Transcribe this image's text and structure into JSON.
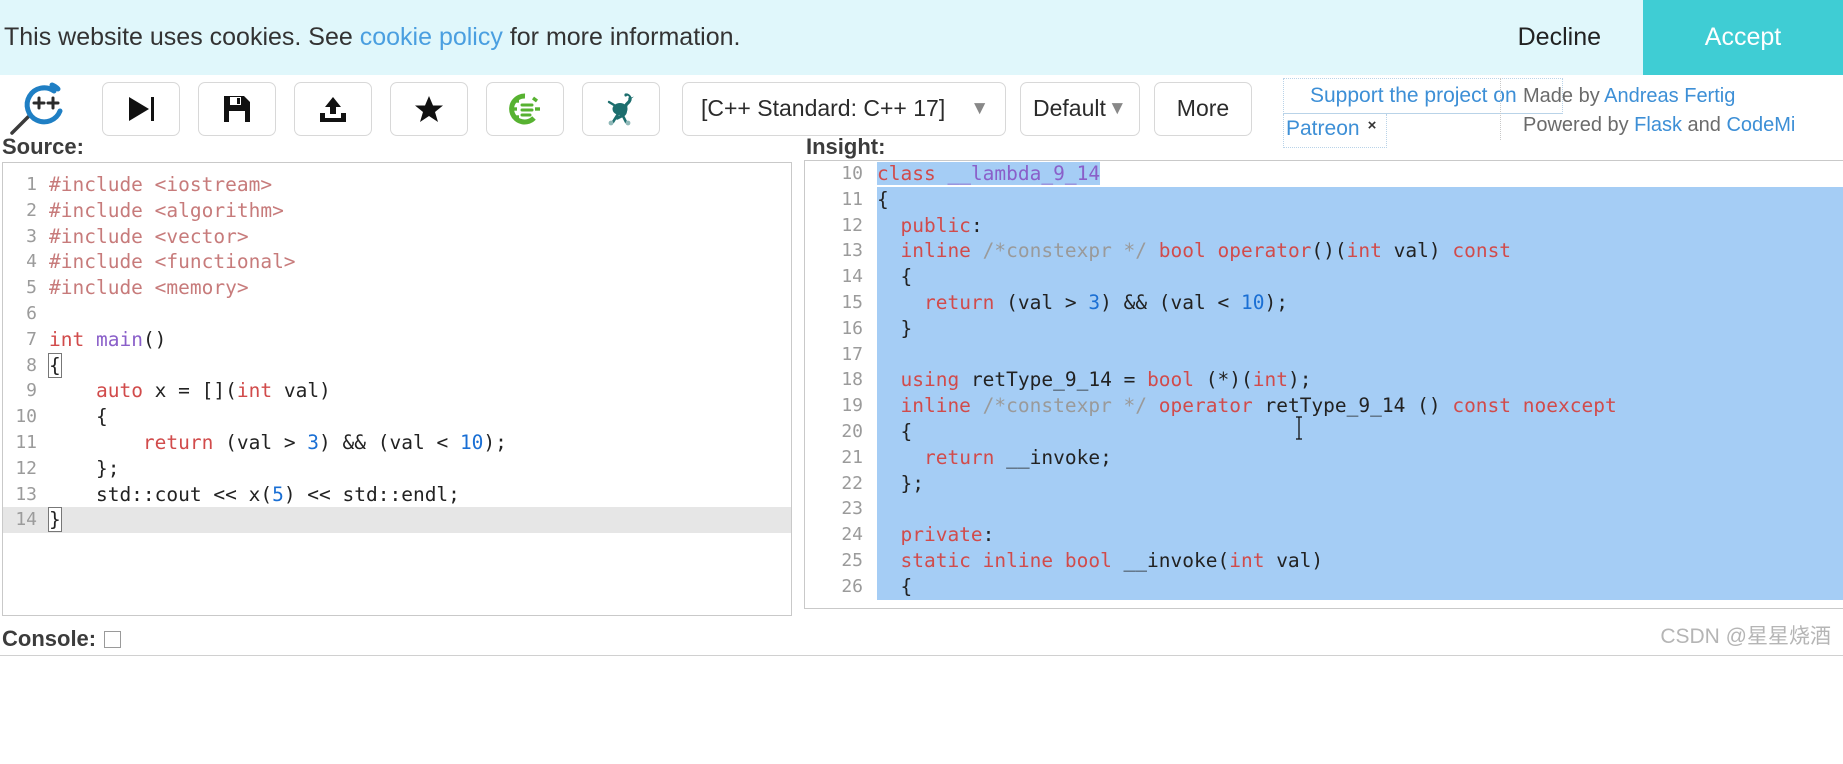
{
  "cookie": {
    "text_before": "This website uses cookies. See ",
    "link": "cookie policy",
    "text_after": " for more information.",
    "decline": "Decline",
    "accept": "Accept",
    "bg": "#e0f7fb",
    "accept_bg": "#3fcdd4"
  },
  "toolbar": {
    "logo_name": "cpp-insights-logo",
    "buttons": [
      {
        "name": "run-button",
        "icon": "play-icon"
      },
      {
        "name": "save-button",
        "icon": "floppy-disk-icon"
      },
      {
        "name": "share-button",
        "icon": "upload-icon"
      },
      {
        "name": "favorite-button",
        "icon": "star-icon"
      },
      {
        "name": "options-button",
        "icon": "green-gear-icon"
      },
      {
        "name": "compiler-explorer-button",
        "icon": "ostrich-icon"
      }
    ],
    "standard_select": "[C++ Standard: C++ 17]",
    "default_select": "Default",
    "more": "More",
    "caret": "▼"
  },
  "patreon": {
    "line1": "Support the project on",
    "line2": "Patreon",
    "close": "×"
  },
  "credits": {
    "line1_prefix": "Made by ",
    "line1_link": "Andreas Fertig",
    "line2_prefix": "Powered by ",
    "line2_link1": "Flask",
    "line2_mid": " and ",
    "line2_link2": "CodeMi"
  },
  "panes": {
    "source_label": "Source:",
    "insight_label": "Insight:"
  },
  "source_code": [
    {
      "n": "1",
      "tokens": [
        {
          "t": "#include ",
          "c": "pp"
        },
        {
          "t": "<iostream>",
          "c": "pp"
        }
      ]
    },
    {
      "n": "2",
      "tokens": [
        {
          "t": "#include ",
          "c": "pp"
        },
        {
          "t": "<algorithm>",
          "c": "pp"
        }
      ]
    },
    {
      "n": "3",
      "tokens": [
        {
          "t": "#include ",
          "c": "pp"
        },
        {
          "t": "<vector>",
          "c": "pp"
        }
      ]
    },
    {
      "n": "4",
      "tokens": [
        {
          "t": "#include ",
          "c": "pp"
        },
        {
          "t": "<functional>",
          "c": "pp"
        }
      ]
    },
    {
      "n": "5",
      "tokens": [
        {
          "t": "#include ",
          "c": "pp"
        },
        {
          "t": "<memory>",
          "c": "pp"
        }
      ]
    },
    {
      "n": "6",
      "tokens": []
    },
    {
      "n": "7",
      "tokens": [
        {
          "t": "int ",
          "c": "kw"
        },
        {
          "t": "main",
          "c": "fn"
        },
        {
          "t": "()",
          "c": "plain"
        }
      ]
    },
    {
      "n": "8",
      "tokens": [
        {
          "t": "{",
          "c": "plain",
          "box": true
        }
      ]
    },
    {
      "n": "9",
      "tokens": [
        {
          "t": "    ",
          "c": "plain"
        },
        {
          "t": "auto",
          "c": "kw"
        },
        {
          "t": " x = [](",
          "c": "plain"
        },
        {
          "t": "int",
          "c": "kw"
        },
        {
          "t": " val)",
          "c": "plain"
        }
      ]
    },
    {
      "n": "10",
      "tokens": [
        {
          "t": "    {",
          "c": "plain"
        }
      ]
    },
    {
      "n": "11",
      "tokens": [
        {
          "t": "        ",
          "c": "plain"
        },
        {
          "t": "return",
          "c": "kw"
        },
        {
          "t": " (val > ",
          "c": "plain"
        },
        {
          "t": "3",
          "c": "num"
        },
        {
          "t": ") && (val < ",
          "c": "plain"
        },
        {
          "t": "10",
          "c": "num"
        },
        {
          "t": ");",
          "c": "plain"
        }
      ]
    },
    {
      "n": "12",
      "tokens": [
        {
          "t": "    };",
          "c": "plain"
        }
      ]
    },
    {
      "n": "13",
      "tokens": [
        {
          "t": "    std::cout << x(",
          "c": "plain"
        },
        {
          "t": "5",
          "c": "num"
        },
        {
          "t": ") << std::endl;",
          "c": "plain"
        }
      ]
    },
    {
      "n": "14",
      "tokens": [
        {
          "t": "}",
          "c": "plain",
          "box": true
        }
      ],
      "active": true
    }
  ],
  "insight_code": [
    {
      "n": "10",
      "sel": "partial",
      "tokens": [
        {
          "t": "class ",
          "c": "kw"
        },
        {
          "t": "__lambda_9_14",
          "c": "fn"
        }
      ]
    },
    {
      "n": "11",
      "sel": "full",
      "tokens": [
        {
          "t": "{",
          "c": "plain"
        }
      ]
    },
    {
      "n": "12",
      "sel": "full",
      "tokens": [
        {
          "t": "  ",
          "c": "plain"
        },
        {
          "t": "public",
          "c": "kw"
        },
        {
          "t": ":",
          "c": "plain"
        }
      ]
    },
    {
      "n": "13",
      "sel": "full",
      "tokens": [
        {
          "t": "  ",
          "c": "plain"
        },
        {
          "t": "inline ",
          "c": "kw"
        },
        {
          "t": "/*constexpr */",
          "c": "cm"
        },
        {
          "t": " ",
          "c": "plain"
        },
        {
          "t": "bool ",
          "c": "kw"
        },
        {
          "t": "operator",
          "c": "kw"
        },
        {
          "t": "()(",
          "c": "plain"
        },
        {
          "t": "int",
          "c": "kw"
        },
        {
          "t": " val) ",
          "c": "plain"
        },
        {
          "t": "const",
          "c": "kw"
        }
      ]
    },
    {
      "n": "14",
      "sel": "full",
      "tokens": [
        {
          "t": "  {",
          "c": "plain"
        }
      ]
    },
    {
      "n": "15",
      "sel": "full",
      "tokens": [
        {
          "t": "    ",
          "c": "plain"
        },
        {
          "t": "return",
          "c": "kw"
        },
        {
          "t": " (val > ",
          "c": "plain"
        },
        {
          "t": "3",
          "c": "num"
        },
        {
          "t": ") && (val < ",
          "c": "plain"
        },
        {
          "t": "10",
          "c": "num"
        },
        {
          "t": ");",
          "c": "plain"
        }
      ]
    },
    {
      "n": "16",
      "sel": "full",
      "tokens": [
        {
          "t": "  }",
          "c": "plain"
        }
      ]
    },
    {
      "n": "17",
      "sel": "full",
      "tokens": []
    },
    {
      "n": "18",
      "sel": "full",
      "tokens": [
        {
          "t": "  ",
          "c": "plain"
        },
        {
          "t": "using ",
          "c": "kw"
        },
        {
          "t": "retType_9_14",
          "c": "plain"
        },
        {
          "t": " = ",
          "c": "plain"
        },
        {
          "t": "bool ",
          "c": "kw"
        },
        {
          "t": "(*)(",
          "c": "plain"
        },
        {
          "t": "int",
          "c": "kw"
        },
        {
          "t": ");",
          "c": "plain"
        }
      ]
    },
    {
      "n": "19",
      "sel": "full",
      "tokens": [
        {
          "t": "  ",
          "c": "plain"
        },
        {
          "t": "inline ",
          "c": "kw"
        },
        {
          "t": "/*constexpr */",
          "c": "cm"
        },
        {
          "t": " ",
          "c": "plain"
        },
        {
          "t": "operator ",
          "c": "kw"
        },
        {
          "t": "retType_9_14",
          "c": "plain"
        },
        {
          "t": " () ",
          "c": "plain"
        },
        {
          "t": "const noexcept",
          "c": "kw"
        }
      ]
    },
    {
      "n": "20",
      "sel": "full",
      "tokens": [
        {
          "t": "  {",
          "c": "plain"
        }
      ]
    },
    {
      "n": "21",
      "sel": "full",
      "tokens": [
        {
          "t": "    ",
          "c": "plain"
        },
        {
          "t": "return",
          "c": "kw"
        },
        {
          "t": " __invoke;",
          "c": "plain"
        }
      ]
    },
    {
      "n": "22",
      "sel": "full",
      "tokens": [
        {
          "t": "  };",
          "c": "plain"
        }
      ]
    },
    {
      "n": "23",
      "sel": "full",
      "tokens": []
    },
    {
      "n": "24",
      "sel": "full",
      "tokens": [
        {
          "t": "  ",
          "c": "plain"
        },
        {
          "t": "private",
          "c": "kw"
        },
        {
          "t": ":",
          "c": "plain"
        }
      ]
    },
    {
      "n": "25",
      "sel": "full",
      "tokens": [
        {
          "t": "  ",
          "c": "plain"
        },
        {
          "t": "static inline bool ",
          "c": "kw"
        },
        {
          "t": "__invoke(",
          "c": "plain"
        },
        {
          "t": "int",
          "c": "kw"
        },
        {
          "t": " val)",
          "c": "plain"
        }
      ]
    },
    {
      "n": "26",
      "sel": "full",
      "tokens": [
        {
          "t": "  {",
          "c": "plain"
        }
      ]
    }
  ],
  "console": {
    "label": "Console:",
    "checkbox_checked": false
  },
  "watermark": "CSDN @星星烧酒"
}
